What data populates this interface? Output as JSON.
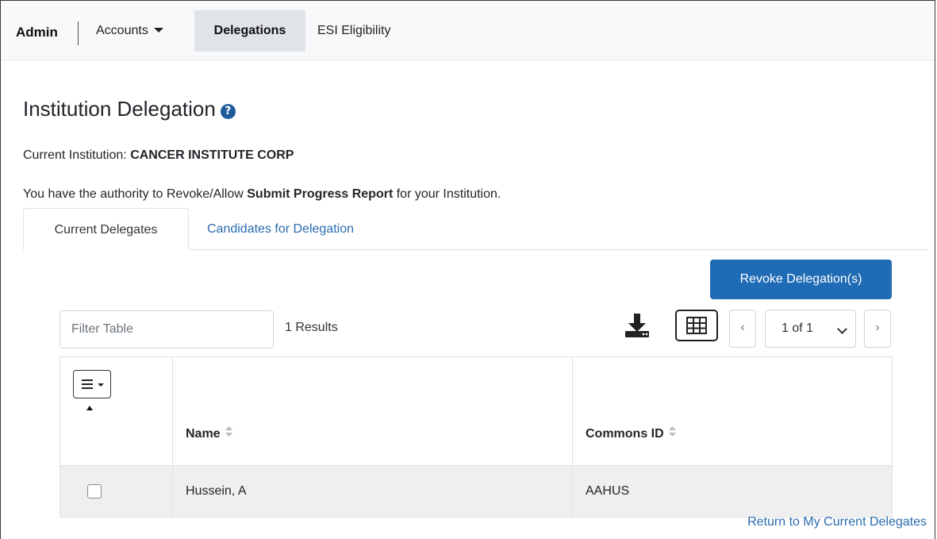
{
  "nav": {
    "brand": "Admin",
    "items": [
      {
        "label": "Accounts",
        "has_dropdown": true
      },
      {
        "label": "Delegations",
        "active": true
      },
      {
        "label": "ESI Eligibility"
      }
    ]
  },
  "page": {
    "title": "Institution Delegation",
    "help_icon": "question-circle-icon",
    "institution_label": "Current Institution:",
    "institution_name": "CANCER INSTITUTE CORP",
    "authority_prefix": "You have the authority to Revoke/Allow ",
    "authority_bold": "Submit Progress Report",
    "authority_suffix": " for your Institution."
  },
  "tabs": [
    {
      "label": "Current Delegates",
      "active": true
    },
    {
      "label": "Candidates for Delegation",
      "active": false
    }
  ],
  "toolbar": {
    "revoke_label": "Revoke Delegation(s)",
    "filter_placeholder": "Filter Table",
    "results_text": "1 Results",
    "prev_label": "‹",
    "next_label": "›",
    "page_value": "1 of 1"
  },
  "table": {
    "columns": [
      "Name",
      "Commons ID"
    ],
    "rows": [
      {
        "name": "Hussein, A",
        "commons_id": "AAHUS",
        "checked": false
      }
    ]
  },
  "footer": {
    "return_link": "Return to My Current Delegates"
  },
  "colors": {
    "primary": "#1f6bb5",
    "link": "#2b6cb0",
    "nav_bg": "#f8f9fa"
  }
}
